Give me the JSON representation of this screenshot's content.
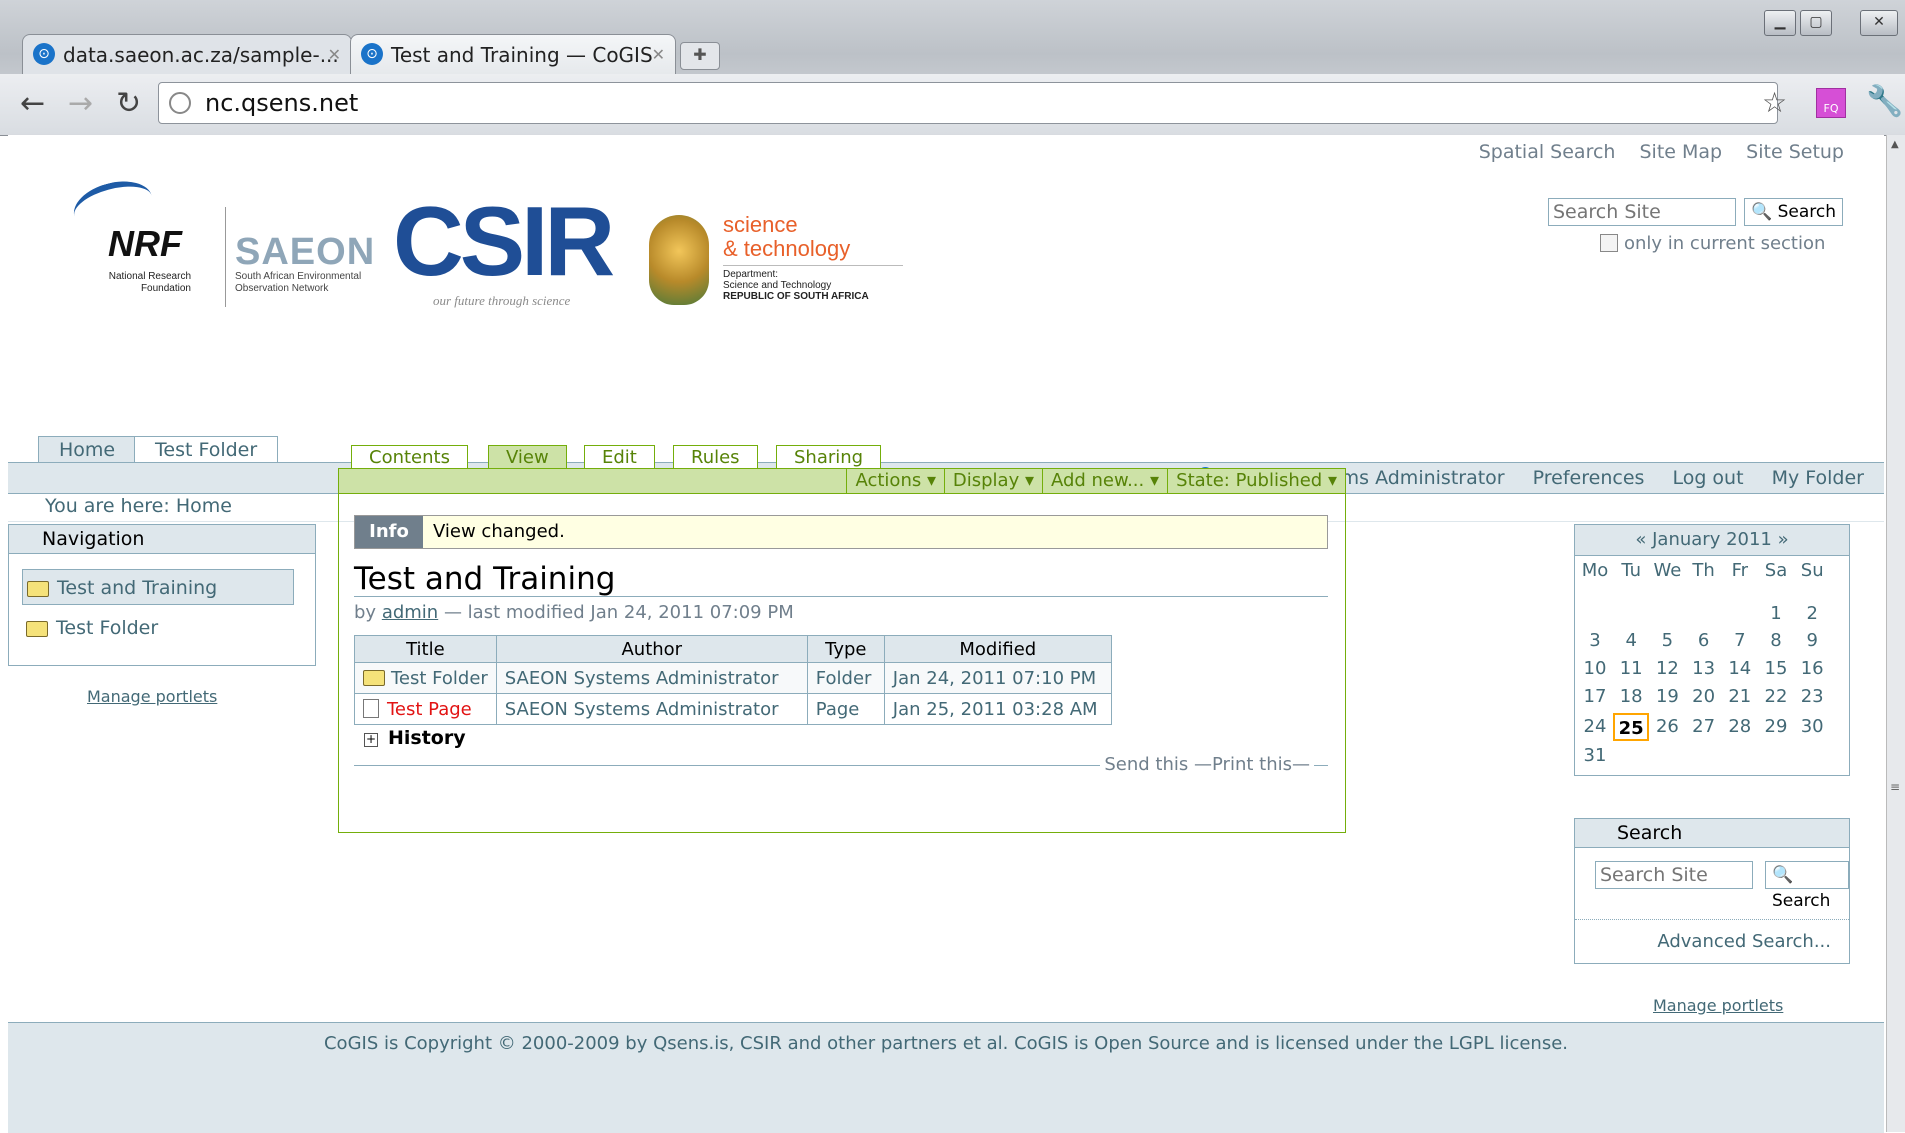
{
  "browser": {
    "tabs": [
      {
        "title": "data.saeon.ac.za/sample-...",
        "active": false
      },
      {
        "title": "Test and Training — CoGIS",
        "active": true
      }
    ],
    "url": "nc.qsens.net",
    "extension_label": "FQ"
  },
  "site_actions": [
    "Spatial Search",
    "Site Map",
    "Site Setup"
  ],
  "top_search": {
    "placeholder": "Search Site",
    "button": "Search",
    "only_current": "only in current section"
  },
  "logos": {
    "nrf": "NRF",
    "nrf_sub": "National Research Foundation",
    "saeon": "SAEON",
    "saeon_sub": "South African Environmental Observation Network",
    "csir": "CSIR",
    "csir_tag": "our future through science",
    "dst_line1": "science",
    "dst_line2": "& technology",
    "dst_dept1": "Department:",
    "dst_dept2": "Science and Technology",
    "dst_dept3": "REPUBLIC OF SOUTH AFRICA"
  },
  "portal_tabs": [
    "Home",
    "Test Folder"
  ],
  "personal_bar": {
    "user": "SAEON Systems Administrator",
    "preferences": "Preferences",
    "logout": "Log out",
    "my_folder": "My Folder"
  },
  "breadcrumbs": {
    "prefix": "You are here:",
    "current": "Home"
  },
  "navigation": {
    "title": "Navigation",
    "items": [
      "Test and Training",
      "Test Folder"
    ],
    "manage": "Manage portlets"
  },
  "content_tabs": [
    "Contents",
    "View",
    "Edit",
    "Rules",
    "Sharing"
  ],
  "content_menus": [
    "Actions ▾",
    "Display ▾",
    "Add new... ▾",
    "State: Published ▾"
  ],
  "info": {
    "label": "Info",
    "message": "View changed."
  },
  "document": {
    "title": "Test and Training",
    "by": "by",
    "author": "admin",
    "modified": "— last modified Jan 24, 2011 07:09 PM"
  },
  "listing": {
    "headers": [
      "Title",
      "Author",
      "Type",
      "Modified"
    ],
    "rows": [
      {
        "title": "Test Folder",
        "author": "SAEON Systems Administrator",
        "type": "Folder",
        "modified": "Jan 24, 2011 07:10 PM"
      },
      {
        "title": "Test Page",
        "author": "SAEON Systems Administrator",
        "type": "Page",
        "modified": "Jan 25, 2011 03:28 AM"
      }
    ]
  },
  "history": "History",
  "doc_actions": {
    "send": "Send this",
    "print": "Print this"
  },
  "calendar": {
    "prev": "«",
    "month": "January 2011",
    "next": "»",
    "dow": [
      "Mo",
      "Tu",
      "We",
      "Th",
      "Fr",
      "Sa",
      "Su"
    ],
    "weeks": [
      [
        "",
        "",
        "",
        "",
        "",
        "1",
        "2"
      ],
      [
        "3",
        "4",
        "5",
        "6",
        "7",
        "8",
        "9"
      ],
      [
        "10",
        "11",
        "12",
        "13",
        "14",
        "15",
        "16"
      ],
      [
        "17",
        "18",
        "19",
        "20",
        "21",
        "22",
        "23"
      ],
      [
        "24",
        "25",
        "26",
        "27",
        "28",
        "29",
        "30"
      ],
      [
        "31",
        "",
        "",
        "",
        "",
        "",
        ""
      ]
    ],
    "today": "25"
  },
  "search_portlet": {
    "title": "Search",
    "placeholder": "Search Site",
    "button": "Search",
    "advanced": "Advanced Search..."
  },
  "right_manage": "Manage portlets",
  "footer": "CoGIS is Copyright © 2000-2009 by Qsens.is, CSIR and other partners et al. CoGIS is Open Source and is licensed under the LGPL license.",
  "colors": {
    "accent_blue": "#436976",
    "light_blue": "#dee7ec",
    "green": "#74ae0b",
    "green_light": "#cde2a7",
    "link_red": "#e21313"
  }
}
